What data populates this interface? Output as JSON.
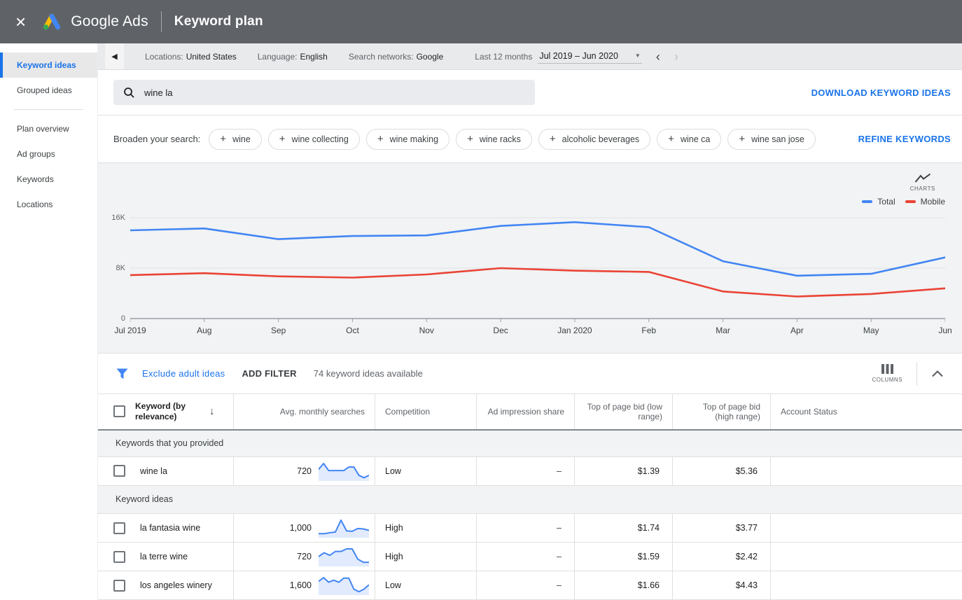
{
  "colors": {
    "accent_blue": "#1a73e8",
    "topbar_bg": "#5f6368",
    "chart_total": "#4285f4",
    "chart_mobile": "#ea4335",
    "sparkline": "#4285f4",
    "sparkline_fill": "rgba(66,133,244,0.16)"
  },
  "icons": {
    "close": "×",
    "collapse_left": "◀",
    "dropdown_caret": "▼",
    "prev_chevron": "‹",
    "next_chevron": "›",
    "sort_desc": "↓",
    "plus": "+"
  },
  "topbar": {
    "brand": "Google Ads",
    "title": "Keyword plan"
  },
  "sidebar": {
    "items": [
      {
        "label": "Keyword ideas",
        "active": true
      },
      {
        "label": "Grouped ideas",
        "active": false
      },
      {
        "label": "Plan overview",
        "active": false
      },
      {
        "label": "Ad groups",
        "active": false
      },
      {
        "label": "Keywords",
        "active": false
      },
      {
        "label": "Locations",
        "active": false
      }
    ]
  },
  "toolbar": {
    "locations_label": "Locations:",
    "locations_value": "United States",
    "language_label": "Language:",
    "language_value": "English",
    "networks_label": "Search networks:",
    "networks_value": "Google",
    "period_label": "Last 12 months",
    "period_value": "Jul 2019 – Jun 2020"
  },
  "search": {
    "value": "wine la",
    "download_label": "DOWNLOAD KEYWORD IDEAS"
  },
  "broaden": {
    "label": "Broaden your search:",
    "chips": [
      "wine",
      "wine collecting",
      "wine making",
      "wine racks",
      "alcoholic beverages",
      "wine ca",
      "wine san jose"
    ],
    "refine_label": "REFINE KEYWORDS"
  },
  "chart_tools": {
    "charts_label": "CHARTS"
  },
  "chart_data": {
    "type": "line",
    "title": "Keyword plan search volume trend",
    "x": [
      "Jul 2019",
      "Aug",
      "Sep",
      "Oct",
      "Nov",
      "Dec",
      "Jan 2020",
      "Feb",
      "Mar",
      "Apr",
      "May",
      "Jun"
    ],
    "series": [
      {
        "name": "Total",
        "color": "#4285f4",
        "values": [
          14000,
          14300,
          12600,
          13100,
          13200,
          14700,
          15300,
          14500,
          9100,
          6800,
          7100,
          9700
        ]
      },
      {
        "name": "Mobile",
        "color": "#ea4335",
        "values": [
          6900,
          7200,
          6700,
          6500,
          7000,
          8000,
          7600,
          7400,
          4300,
          3500,
          3900,
          4800
        ]
      }
    ],
    "ylim": [
      0,
      16000
    ],
    "yticks": [
      {
        "value": 16000,
        "label": "16K"
      },
      {
        "value": 8000,
        "label": "8K"
      },
      {
        "value": 0,
        "label": "0"
      }
    ],
    "grid": true,
    "legend_position": "top-right"
  },
  "filter_bar": {
    "exclude_label": "Exclude adult ideas",
    "add_filter_label": "ADD FILTER",
    "count_text": "74 keyword ideas available",
    "columns_label": "COLUMNS"
  },
  "table": {
    "headers": {
      "keyword": "Keyword (by relevance)",
      "avg_monthly_searches": "Avg. monthly searches",
      "competition": "Competition",
      "ad_impression_share": "Ad impression share",
      "top_of_page_bid_low": "Top of page bid (low range)",
      "top_of_page_bid_high": "Top of page bid (high range)",
      "account_status": "Account Status"
    },
    "sections": [
      {
        "label": "Keywords that you provided",
        "rows": [
          {
            "keyword": "wine la",
            "avg_monthly_searches": "720",
            "competition": "Low",
            "ad_impression_share": "–",
            "top_bid_low": "$1.39",
            "top_bid_high": "$5.36",
            "account_status": "",
            "sparkline": [
              4,
              6.5,
              3.5,
              3.5,
              3.5,
              3.5,
              5,
              5,
              1.5,
              0.5,
              1.5
            ]
          }
        ]
      },
      {
        "label": "Keyword ideas",
        "rows": [
          {
            "keyword": "la fantasia wine",
            "avg_monthly_searches": "1,000",
            "competition": "High",
            "ad_impression_share": "–",
            "top_bid_low": "$1.74",
            "top_bid_high": "$3.77",
            "account_status": "",
            "sparkline": [
              0.8,
              0.8,
              1.2,
              1.5,
              6.5,
              2,
              1.8,
              3,
              2.8,
              2.2
            ]
          },
          {
            "keyword": "la terre wine",
            "avg_monthly_searches": "720",
            "competition": "High",
            "ad_impression_share": "–",
            "top_bid_low": "$1.59",
            "top_bid_high": "$2.42",
            "account_status": "",
            "sparkline": [
              3,
              4.5,
              3.5,
              5,
              5,
              6,
              6,
              2,
              0.8,
              0.8
            ]
          },
          {
            "keyword": "los angeles winery",
            "avg_monthly_searches": "1,600",
            "competition": "Low",
            "ad_impression_share": "–",
            "top_bid_low": "$1.66",
            "top_bid_high": "$4.43",
            "account_status": "",
            "sparkline": [
              4.5,
              6,
              4.2,
              5,
              4.2,
              5.8,
              5.8,
              1.5,
              0.5,
              1.5,
              3.2
            ]
          }
        ]
      }
    ]
  }
}
